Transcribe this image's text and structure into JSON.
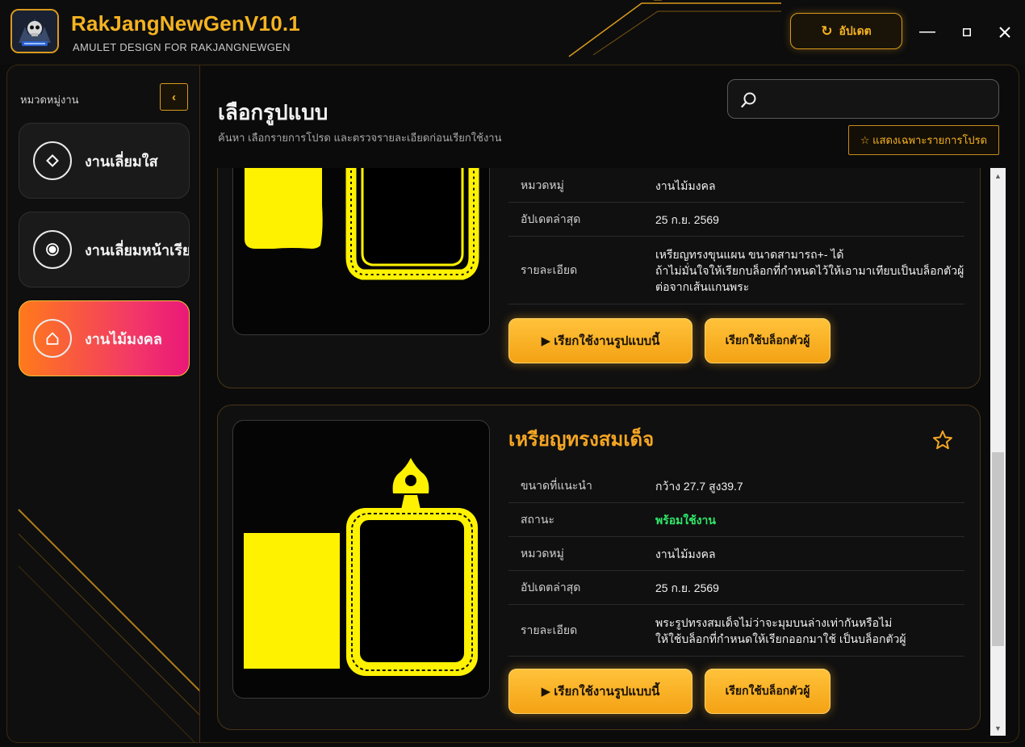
{
  "app": {
    "title": "RakJangNewGenV10.1",
    "subtitle": "AMULET DESIGN FOR RAKJANGNEWGEN",
    "logo_icon": "skull-logo-icon",
    "update_label": "อัปเดต",
    "update_icon": "refresh-icon",
    "accent": "#f5b321"
  },
  "window_controls": {
    "minimize": "—",
    "maximize": "□",
    "close": "✕"
  },
  "sidebar": {
    "heading": "หมวดหมู่งาน",
    "collapse_icon": "‹",
    "items": [
      {
        "label": "งานเลี่ยมใส",
        "icon": "diamond-icon",
        "active": false
      },
      {
        "label": "งานเลี่ยมหน้าเรียบ",
        "icon": "radio-dot-icon",
        "active": false
      },
      {
        "label": "งานไม้มงคล",
        "icon": "home-icon",
        "active": true
      }
    ]
  },
  "header": {
    "title": "เลือกรูปแบบ",
    "subtitle": "ค้นหา เลือกรายการโปรด และตรวจรายละเอียดก่อนเรียกใช้งาน",
    "search_placeholder": "",
    "favorites_filter_label": "☆ แสดงเฉพาะรายการโปรด"
  },
  "labels": {
    "size": "ขนาดที่แนะนำ",
    "status": "สถานะ",
    "category": "หมวดหมู่",
    "updated": "อัปเดตล่าสุด",
    "details": "รายละเอียด",
    "use_template": "▶  เรียกใช้งานรูปแบบนี้",
    "use_block": "เรียกใช้บล็อกตัวผู้"
  },
  "cards": [
    {
      "title": "",
      "category": "งานไม้มงคล",
      "updated": "25 ก.ย. 2569",
      "details_lines": [
        "เหรียญทรงขุนแผน ขนาดสามารถ+- ได้",
        "ถ้าไม่มั่นใจให้เรียกบล็อกที่กำหนดไว้ให้เอามาเทียบเป็นบล็อกตัวผู้",
        "ต่อจากเส้นแกนพระ"
      ]
    },
    {
      "title": "เหรียญทรงสมเด็จ",
      "size": "กว้าง 27.7 สูง39.7",
      "status": "พร้อมใช้งาน",
      "status_color": "#2ee86a",
      "category": "งานไม้มงคล",
      "updated": "25 ก.ย. 2569",
      "favorite": false,
      "details_lines": [
        "พระรูปทรงสมเด็จไม่ว่าจะมุมบนล่างเท่ากันหรือไม่",
        "ให้ใช้บล็อกที่กำหนดให้เรียกออกมาใช้ เป็นบล็อกตัวผู้"
      ]
    }
  ]
}
